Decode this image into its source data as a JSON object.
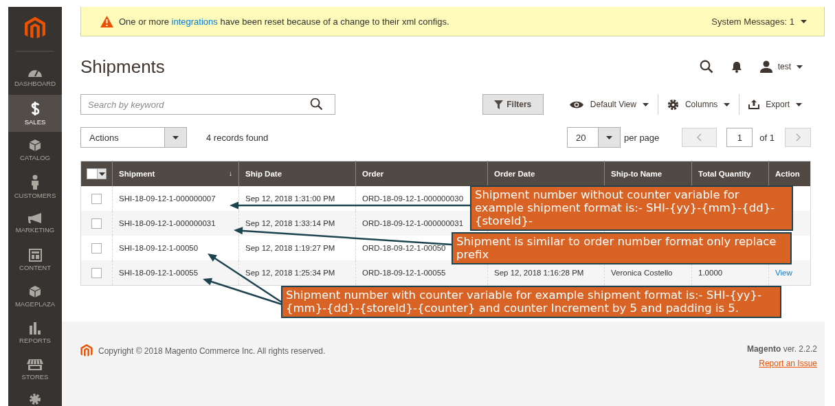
{
  "sidebar": {
    "items": [
      {
        "label": "DASHBOARD",
        "selected": false
      },
      {
        "label": "SALES",
        "selected": true
      },
      {
        "label": "CATALOG",
        "selected": false
      },
      {
        "label": "CUSTOMERS",
        "selected": false
      },
      {
        "label": "MARKETING",
        "selected": false
      },
      {
        "label": "CONTENT",
        "selected": false
      },
      {
        "label": "MAGEPLAZA",
        "selected": false
      },
      {
        "label": "REPORTS",
        "selected": false
      },
      {
        "label": "STORES",
        "selected": false
      }
    ]
  },
  "system_message": {
    "before": "One or more ",
    "link": "integrations",
    "after": " have been reset because of a change to their xml configs.",
    "counter": "System Messages: 1"
  },
  "page_title": "Shipments",
  "header": {
    "user": "test"
  },
  "search": {
    "placeholder": "Search by keyword"
  },
  "toolbar": {
    "filters": "Filters",
    "view": "Default View",
    "columns": "Columns",
    "export": "Export"
  },
  "actions": {
    "select": "Actions",
    "records": "4 records found"
  },
  "pager": {
    "per_page_value": "20",
    "per_page_label": "per page",
    "page": "1",
    "of": "of 1"
  },
  "table": {
    "mass_select": {
      "checked": false
    },
    "columns": [
      {
        "label": "Shipment",
        "sort": "↓"
      },
      {
        "label": "Ship Date"
      },
      {
        "label": "Order"
      },
      {
        "label": "Order Date"
      },
      {
        "label": "Ship-to Name"
      },
      {
        "label": "Total Quantity"
      },
      {
        "label": "Action"
      }
    ],
    "rows": [
      {
        "checked": false,
        "cells": {
          "shipment": "SHI-18-09-12-1-000000007",
          "ship_date": "Sep 12, 2018 1:31:00 PM",
          "order": "ORD-18-09-12-1-000000030"
        }
      },
      {
        "checked": false,
        "cells": {
          "shipment": "SHI-18-09-12-1-000000031",
          "ship_date": "Sep 12, 2018 1:33:14 PM",
          "order": "ORD-18-09-12-1-000000031"
        }
      },
      {
        "checked": false,
        "cells": {
          "shipment": "SHI-18-09-12-1-00050",
          "ship_date": "Sep 12, 2018 1:19:27 PM",
          "order": "ORD-18-09-12-1-00050"
        }
      },
      {
        "checked": false,
        "cells": {
          "shipment": "SHI-18-09-12-1-00055",
          "ship_date": "Sep 12, 2018 1:25:34 PM",
          "order": "ORD-18-09-12-1-00055",
          "order_date": "Sep 12, 2018 1:16:28 PM",
          "ship_to_name": "Veronica Costello",
          "total_quantity": "1.0000",
          "action": "View"
        }
      }
    ]
  },
  "annotations": [
    {
      "text": "Shipment number without counter variable for example shipment format is:- SHI-{yy}-{mm}-{dd}-{storeId}-"
    },
    {
      "text": "Shipment is similar to order number format only replace prefix"
    },
    {
      "text": "Shipment number with counter variable for example shipment format is:- SHI-{yy}-{mm}-{dd}-{storeId}-{counter} and counter Increment by 5 and padding is 5."
    }
  ],
  "footer": {
    "copyright": "Copyright © 2018 Magento Commerce Inc. All rights reserved.",
    "version": "**Magento** ver. 2.2.2",
    "report_link": "Report an Issue"
  }
}
